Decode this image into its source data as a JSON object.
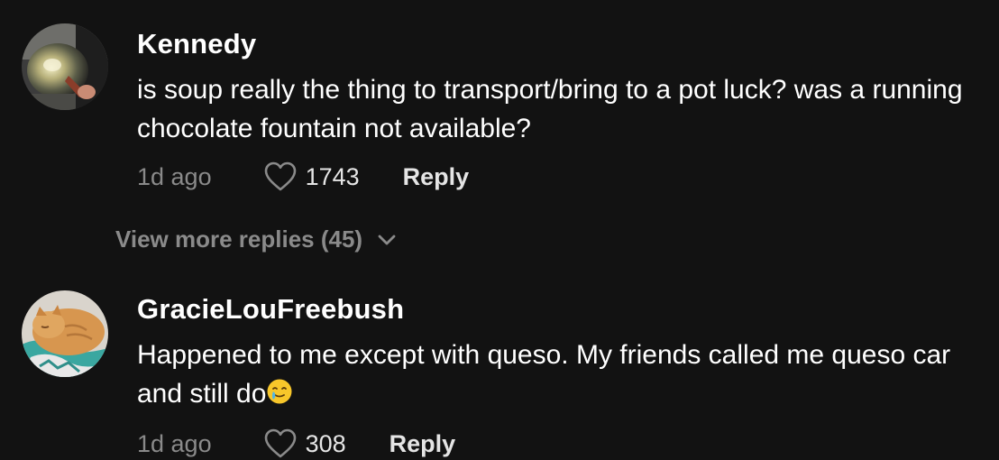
{
  "comments": [
    {
      "username": "Kennedy",
      "text": "is soup really the thing to transport/bring to a pot luck? was a running chocolate fountain not available?",
      "time": "1d ago",
      "likes": "1743",
      "reply_label": "Reply",
      "avatar": "kettle-reflection-photo"
    },
    {
      "username": "GracieLouFreebush",
      "text": "Happened to me except with queso. My friends called me queso car and still do",
      "emoji": "smiling-face-with-tear-icon",
      "time": "1d ago",
      "likes": "308",
      "reply_label": "Reply",
      "avatar": "orange-cat-photo"
    }
  ],
  "view_more": {
    "label": "View more replies (45)"
  },
  "colors": {
    "background": "#121212",
    "primary_text": "#ffffff",
    "secondary_text": "#8a8a8a"
  }
}
